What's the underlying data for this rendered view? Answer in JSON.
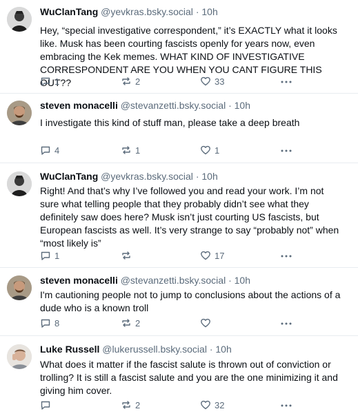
{
  "posts": [
    {
      "name": "WuClanTang",
      "handle": "@yevkras.bsky.social",
      "time": "10h",
      "lines": [
        "Hey, “special investigative correspondent,” it’s EXACTLY what it looks",
        "like. Musk has been courting fascists openly for years now, even",
        "embracing the Kek memes. WHAT KIND OF INVESTIGATIVE",
        "CORRESPONDENT ARE YOU WHEN YOU CANT FIGURE THIS OUT??"
      ],
      "replies": "1",
      "reposts": "2",
      "likes": "33"
    },
    {
      "name": "steven monacelli",
      "handle": "@stevanzetti.bsky.social",
      "time": "10h",
      "lines": [
        "I investigate this kind of stuff man, please take a deep breath"
      ],
      "replies": "4",
      "reposts": "1",
      "likes": "1"
    },
    {
      "name": "WuClanTang",
      "handle": "@yevkras.bsky.social",
      "time": "10h",
      "lines": [
        "Right!  And that’s why I’ve followed you and read your work. I’m not",
        "sure what telling people that they probably didn’t see what they",
        "definitely saw does here?  Musk isn’t just courting US fascists, but",
        "European fascists as well. It’s very strange to say “probably not” when",
        "“most likely is”"
      ],
      "replies": "1",
      "reposts": "",
      "likes": "17"
    },
    {
      "name": "steven monacelli",
      "handle": "@stevanzetti.bsky.social",
      "time": "10h",
      "lines": [
        "I'm cautioning people not to jump to conclusions about the actions of a",
        "dude who is a known troll"
      ],
      "replies": "8",
      "reposts": "2",
      "likes": ""
    },
    {
      "name": "Luke Russell",
      "handle": "@lukerussell.bsky.social",
      "time": "10h",
      "lines": [
        "What does it matter if the fascist salute is thrown out of conviction or",
        "trolling? It is still a fascist salute and you are the one minimizing it and",
        "giving him cover."
      ],
      "replies": "",
      "reposts": "2",
      "likes": "32"
    }
  ],
  "separator": "·"
}
